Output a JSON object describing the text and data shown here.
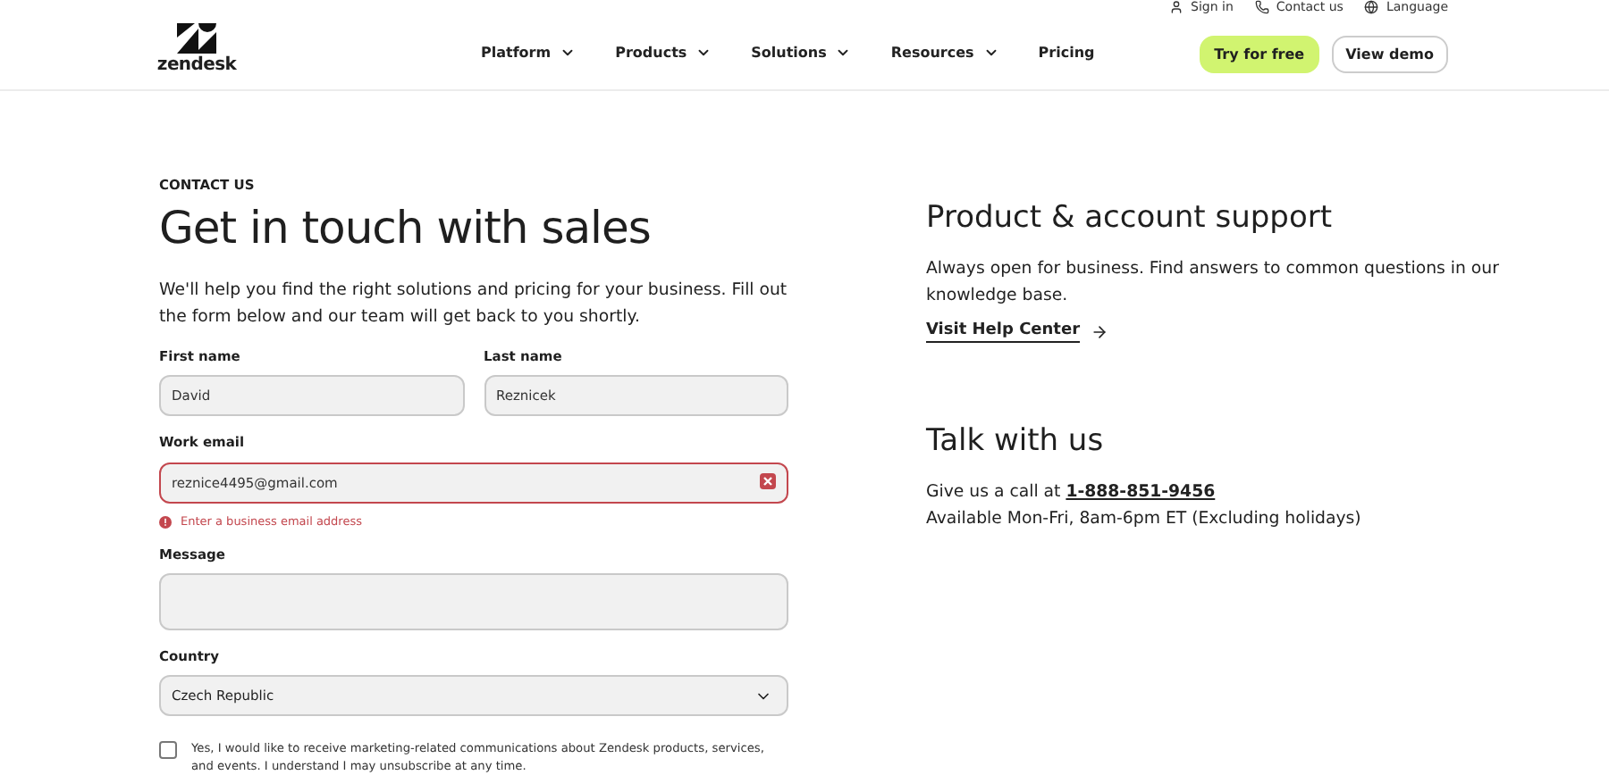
{
  "header": {
    "logo_text": "zendesk",
    "utility_links": [
      {
        "kind": "user",
        "label": "Sign in"
      },
      {
        "kind": "phone",
        "label": "Contact us"
      },
      {
        "kind": "globe",
        "label": "Language"
      }
    ],
    "nav": [
      {
        "label": "Platform",
        "dropdown": true
      },
      {
        "label": "Products",
        "dropdown": true
      },
      {
        "label": "Solutions",
        "dropdown": true
      },
      {
        "label": "Resources",
        "dropdown": true
      },
      {
        "label": "Pricing",
        "dropdown": false
      }
    ],
    "buttons": [
      {
        "kind": "primary",
        "label": "Try for free"
      },
      {
        "kind": "secondary",
        "label": "View demo"
      }
    ]
  },
  "form": {
    "eyebrow": "CONTACT US",
    "title": "Get in touch with sales",
    "intro": "We'll help you find the right solutions and pricing for your business. Fill out the form below and our team will get back to you shortly.",
    "first_name": {
      "label": "First name",
      "value": "David"
    },
    "last_name": {
      "label": "Last name",
      "value": "Reznicek"
    },
    "work_email": {
      "label": "Work email",
      "value": "reznice4495@gmail.com",
      "error": true,
      "error_text": "Enter a business email address"
    },
    "message": {
      "label": "Message"
    },
    "country": {
      "label": "Country",
      "value": "Czech Republic"
    },
    "consent": {
      "checked": false,
      "text": "Yes, I would like to receive marketing-related communications about Zendesk products, services, and events. I understand I may unsubscribe at any time."
    }
  },
  "aside": [
    {
      "title": "Product & account support",
      "lines": [
        "Always open for business. Find answers to common questions in our knowledge base."
      ],
      "link": "Visit Help Center"
    },
    {
      "title": "Talk with us",
      "call_prefix": "Give us a call at",
      "phone": "1-888-851-9456",
      "lines": [
        "Available Mon-Fri, 8am-6pm ET (Excluding holidays)"
      ]
    }
  ]
}
